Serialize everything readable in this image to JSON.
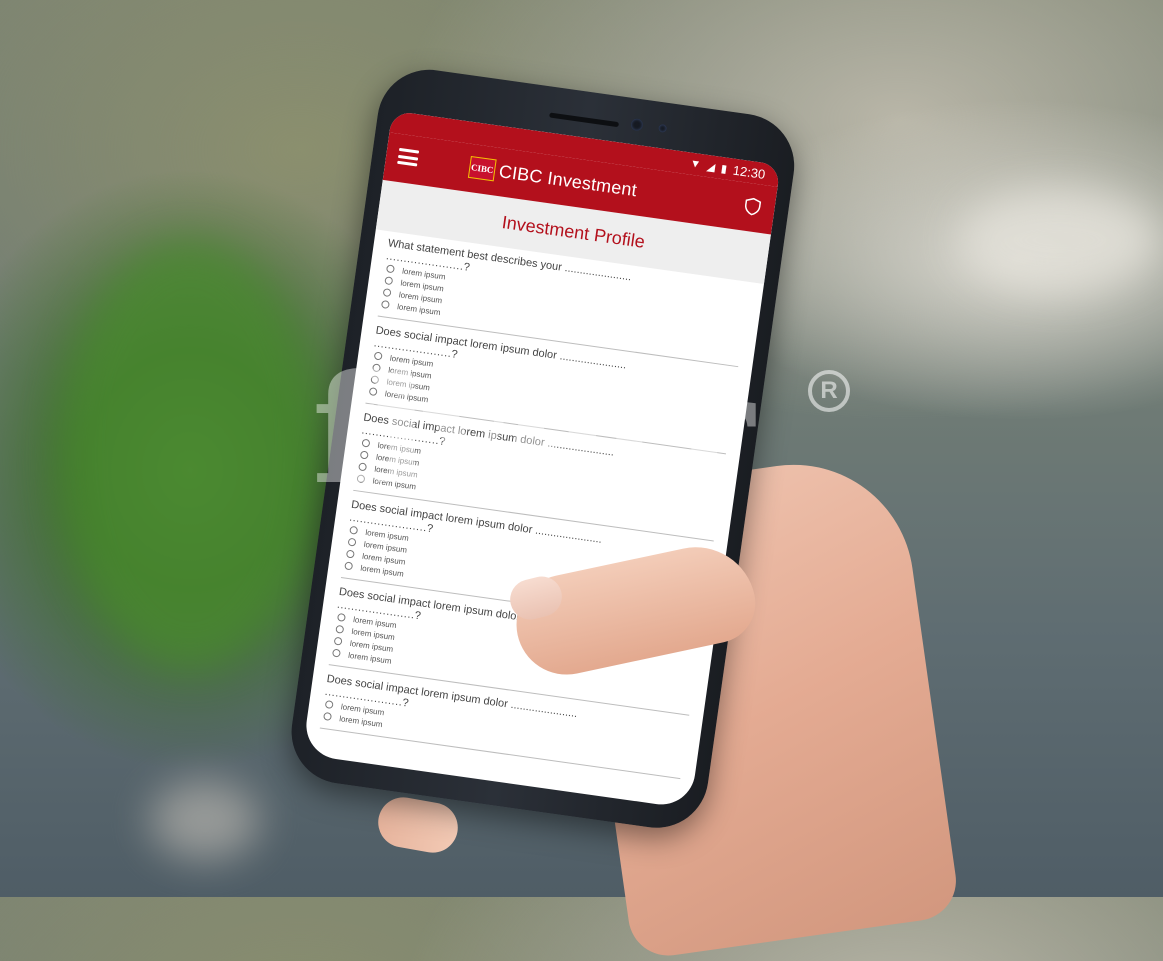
{
  "status_bar": {
    "time": "12:30"
  },
  "app_bar": {
    "logo_text": "CIBC",
    "title": "CIBC Investment"
  },
  "page": {
    "title": "Investment Profile"
  },
  "questions": [
    {
      "text": "What statement best describes your ......................",
      "cont": "......................?",
      "options": [
        "lorem ipsum",
        "lorem ipsum",
        "lorem ipsum",
        "lorem ipsum"
      ]
    },
    {
      "text": "Does social impact lorem ipsum dolor ......................",
      "cont": "......................?",
      "options": [
        "lorem ipsum",
        "lorem ipsum",
        "lorem ipsum",
        "lorem ipsum"
      ]
    },
    {
      "text": "Does social impact lorem ipsum dolor ......................",
      "cont": "......................?",
      "options": [
        "lorem ipsum",
        "lorem ipsum",
        "lorem ipsum",
        "lorem ipsum"
      ]
    },
    {
      "text": "Does social impact lorem ipsum dolor ......................",
      "cont": "......................?",
      "options": [
        "lorem ipsum",
        "lorem ipsum",
        "lorem ipsum",
        "lorem ipsum"
      ]
    },
    {
      "text": "Does social impact lorem ipsum dolor ......................",
      "cont": "......................?",
      "options": [
        "lorem ipsum",
        "lorem ipsum",
        "lorem ipsum",
        "lorem ipsum"
      ]
    },
    {
      "text": "Does social impact lorem ipsum dolor ......................",
      "cont": "......................?",
      "options": [
        "lorem ipsum",
        "lorem ipsum"
      ]
    }
  ],
  "watermark": {
    "text": "fiverr",
    "mark": "R"
  },
  "colors": {
    "brand_red": "#b3101c",
    "header_bg": "#eeeeee"
  }
}
